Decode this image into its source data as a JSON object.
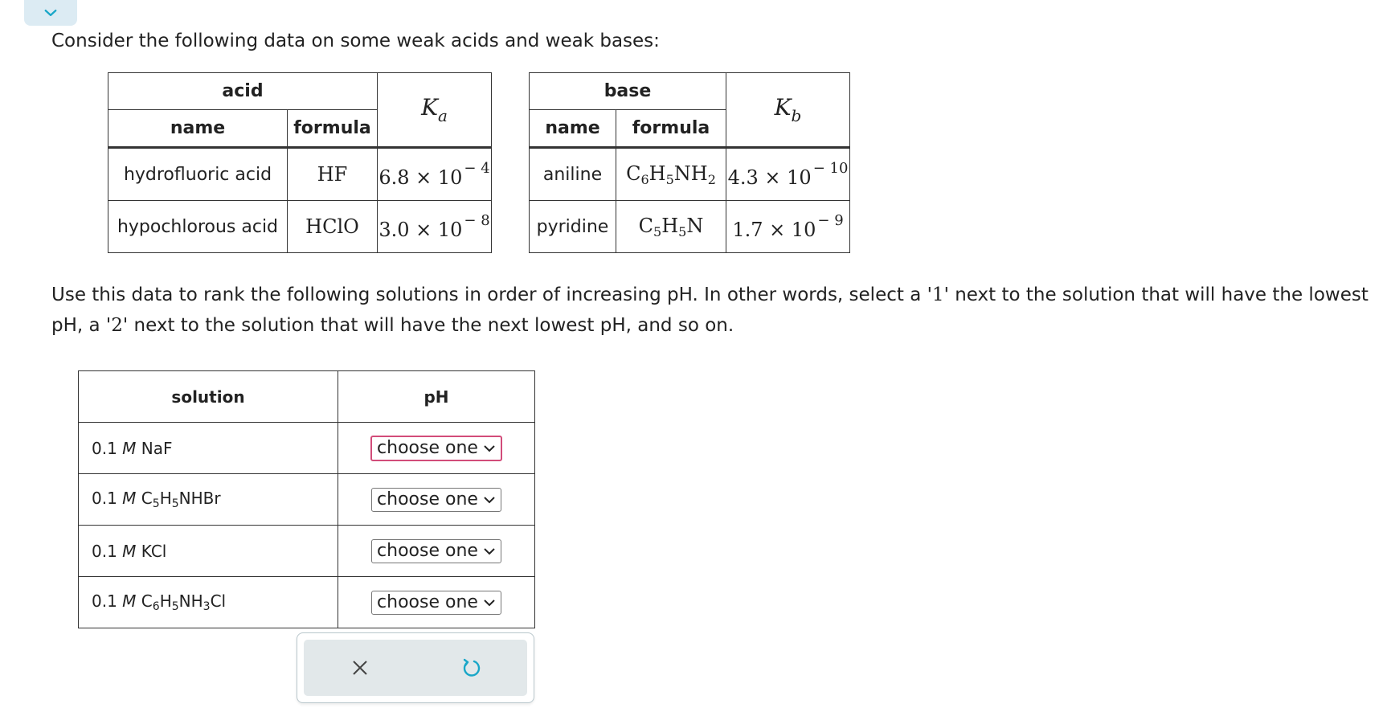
{
  "intro_text": "Consider the following data on some weak acids and weak bases:",
  "acid_table": {
    "group_header": "acid",
    "col_name": "name",
    "col_formula": "formula",
    "k_symbol": "K",
    "k_subscript": "a",
    "rows": [
      {
        "name": "hydrofluoric acid",
        "formula": "HF",
        "k_mantissa": "6.8",
        "k_exponent": "− 4"
      },
      {
        "name": "hypochlorous acid",
        "formula": "HClO",
        "k_mantissa": "3.0",
        "k_exponent": "− 8"
      }
    ]
  },
  "base_table": {
    "group_header": "base",
    "col_name": "name",
    "col_formula": "formula",
    "k_symbol": "K",
    "k_subscript": "b",
    "rows": [
      {
        "name": "aniline",
        "formula_parts": [
          "C",
          "6",
          "H",
          "5",
          "NH",
          "2"
        ],
        "k_mantissa": "4.3",
        "k_exponent": "− 10"
      },
      {
        "name": "pyridine",
        "formula_parts": [
          "C",
          "5",
          "H",
          "5",
          "N",
          ""
        ],
        "k_mantissa": "1.7",
        "k_exponent": "− 9"
      }
    ]
  },
  "times_ten": "× 10",
  "instruction": {
    "part1": "Use this data to rank the following solutions in order of increasing pH. In other words, select a '",
    "num1": "1",
    "part2": "' next to the solution that will have the lowest pH, a '",
    "num2": "2",
    "part3": "' next to the solution that will have the next lowest pH, and so on."
  },
  "rank_table": {
    "col_solution": "solution",
    "col_ph": "pH",
    "rows": [
      {
        "conc": "0.1",
        "unit": "M",
        "formula_parts": [
          "NaF",
          "",
          "",
          "",
          "",
          ""
        ],
        "select_value": "choose one"
      },
      {
        "conc": "0.1",
        "unit": "M",
        "formula_parts": [
          "C",
          "5",
          "H",
          "5",
          "NHBr",
          ""
        ],
        "select_value": "choose one"
      },
      {
        "conc": "0.1",
        "unit": "M",
        "formula_parts": [
          "KCl",
          "",
          "",
          "",
          "",
          ""
        ],
        "select_value": "choose one"
      },
      {
        "conc": "0.1",
        "unit": "M",
        "formula_parts": [
          "C",
          "6",
          "H",
          "5",
          "NH",
          "3"
        ],
        "formula_tail": "Cl",
        "select_value": "choose one"
      }
    ]
  },
  "icons": {
    "collapse": "chevron-down-icon",
    "clear": "close-icon",
    "reset": "undo-icon"
  },
  "colors": {
    "accent": "#1aa7c8",
    "active_select_border": "#d24c7a",
    "toolbar_bg": "#e2e8ea"
  }
}
